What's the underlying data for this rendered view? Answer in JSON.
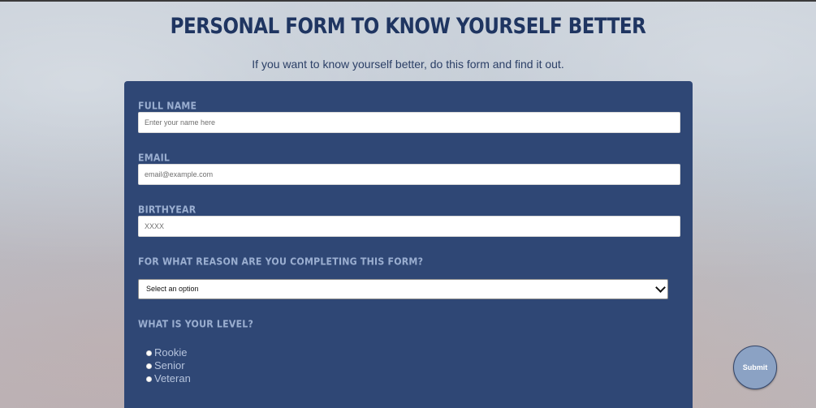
{
  "header": {
    "title": "PERSONAL FORM TO KNOW YOURSELF BETTER",
    "subtitle": "If you want to know yourself better, do this form and find it out."
  },
  "form": {
    "full_name": {
      "label": "FULL NAME",
      "placeholder": "Enter your name here"
    },
    "email": {
      "label": "EMAIL",
      "placeholder": "email@example.com"
    },
    "birthyear": {
      "label": "BIRTHYEAR",
      "placeholder": "XXXX"
    },
    "reason": {
      "label": "FOR WHAT REASON ARE YOU COMPLETING THIS FORM?",
      "selected": "Select an option"
    },
    "level": {
      "label": "WHAT IS YOUR LEVEL?",
      "options": [
        "Rookie",
        "Senior",
        "Veteran"
      ]
    },
    "submit_label": "Submit"
  },
  "colors": {
    "title": "#1f3561",
    "panel": "#2f4775",
    "label": "#9aaed0",
    "submit": "#8ba2c4"
  }
}
